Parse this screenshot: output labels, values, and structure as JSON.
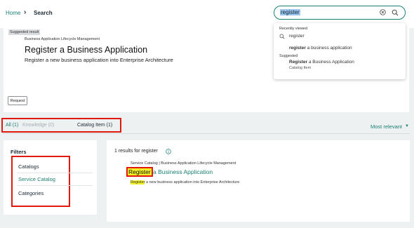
{
  "breadcrumb": {
    "home": "Home",
    "separator": "›",
    "current": "Search"
  },
  "search": {
    "value": "register"
  },
  "dropdown": {
    "recent_heading": "Recently viewed",
    "recent_term": "register",
    "recent_item_bold": "register",
    "recent_item_rest": " a business application",
    "suggested_heading": "Suggested",
    "suggested_title_bold": "Register",
    "suggested_title_rest": " a Business Application",
    "suggested_subtitle": "Catalog Item"
  },
  "suggested_result": {
    "badge": "Suggested result",
    "category": "Business Application Lifecycle Management",
    "title": "Register a Business Application",
    "description": "Register a new business application into Enterprise Architecture",
    "button": "Request"
  },
  "tabs": {
    "all": "All (1)",
    "knowledge": "Knowledge (0)",
    "catalog": "Catalog Item (1)"
  },
  "sort": {
    "label": "Most relevant"
  },
  "filters": {
    "title": "Filters",
    "items": [
      "Catalogs",
      "Service Catalog",
      "Categories"
    ]
  },
  "results": {
    "count_text": "1 results for register",
    "path": "Service Catalog | Business Application Lifecycle Management",
    "title_mark": "Register",
    "title_rest": "a Business Application",
    "desc_mark": "Register",
    "desc_rest": " a new business application into Enterprise Architecture"
  },
  "colors": {
    "accent": "#1a7f73",
    "highlight_box": "#e0190c",
    "search_highlight": "#f3f32a"
  }
}
